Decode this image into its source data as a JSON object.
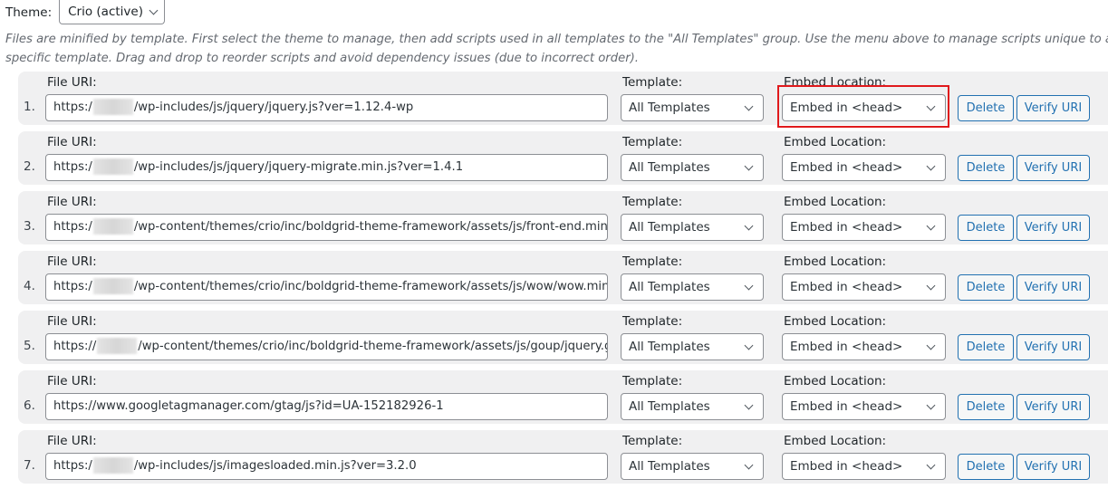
{
  "theme": {
    "label": "Theme:",
    "selected": "Crio (active)"
  },
  "description": "Files are minified by template. First select the theme to manage, then add scripts used in all templates to the \"All Templates\" group. Use the menu above to manage scripts unique to a specific template. Drag and drop to reorder scripts and avoid dependency issues (due to incorrect order).",
  "labels": {
    "file_uri": "File URI:",
    "template": "Template:",
    "embed_location": "Embed Location:"
  },
  "buttons": {
    "delete": "Delete",
    "verify": "Verify URI"
  },
  "scripts": [
    {
      "index": "1.",
      "uri_prefix": "https:/",
      "redacted": true,
      "uri_suffix": "/wp-includes/js/jquery/jquery.js?ver=1.12.4-wp",
      "template": "All Templates",
      "embed": "Embed in <head>"
    },
    {
      "index": "2.",
      "uri_prefix": "https:/",
      "redacted": true,
      "uri_suffix": "/wp-includes/js/jquery/jquery-migrate.min.js?ver=1.4.1",
      "template": "All Templates",
      "embed": "Embed in <head>"
    },
    {
      "index": "3.",
      "uri_prefix": "https:/",
      "redacted": true,
      "uri_suffix": "/wp-content/themes/crio/inc/boldgrid-theme-framework/assets/js/front-end.min.js",
      "template": "All Templates",
      "embed": "Embed in <head>"
    },
    {
      "index": "4.",
      "uri_prefix": "https:/",
      "redacted": true,
      "uri_suffix": "/wp-content/themes/crio/inc/boldgrid-theme-framework/assets/js/wow/wow.min.js",
      "template": "All Templates",
      "embed": "Embed in <head>"
    },
    {
      "index": "5.",
      "uri_prefix": "https://",
      "redacted": true,
      "uri_suffix": "/wp-content/themes/crio/inc/boldgrid-theme-framework/assets/js/goup/jquery.goup.min.js",
      "template": "All Templates",
      "embed": "Embed in <head>"
    },
    {
      "index": "6.",
      "uri_prefix": "https://www.googletagmanager.com/gtag/js?id=UA-152182926-1",
      "redacted": false,
      "uri_suffix": "",
      "template": "All Templates",
      "embed": "Embed in <head>"
    },
    {
      "index": "7.",
      "uri_prefix": "https:/",
      "redacted": true,
      "uri_suffix": "/wp-includes/js/imagesloaded.min.js?ver=3.2.0",
      "template": "All Templates",
      "embed": "Embed in <head>"
    }
  ],
  "colors": {
    "accent": "#2271b1",
    "highlight": "#e0191c",
    "row_bg": "#f0f0f1"
  }
}
